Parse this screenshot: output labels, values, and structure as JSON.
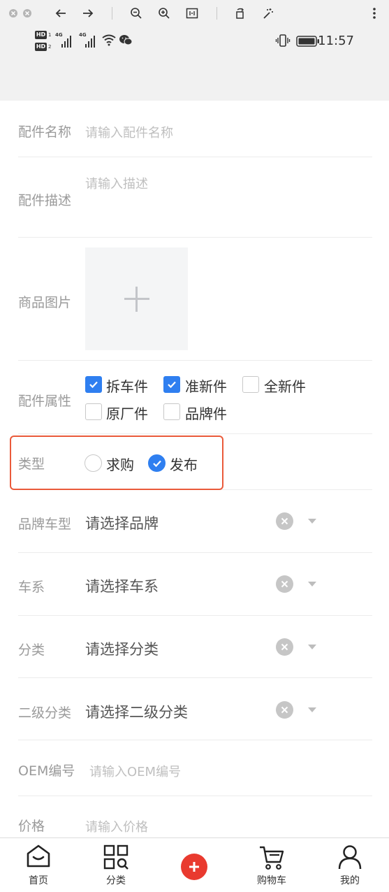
{
  "status_bar": {
    "sim1_badge": "HD",
    "sim1_num": "1",
    "sim2_badge": "HD",
    "sim2_num": "2",
    "net1": "4G",
    "net2": "4G",
    "time": "11:57",
    "icons": [
      "hd-icon",
      "signal-icon",
      "wifi-icon",
      "wechat-icon",
      "vibrate-icon",
      "battery-icon"
    ]
  },
  "viewer_toolbar": {
    "icons": [
      "close-icon",
      "minimize-icon",
      "back-arrow-icon",
      "forward-arrow-icon",
      "zoom-out-icon",
      "zoom-in-icon",
      "fit-icon",
      "rotate-icon",
      "magic-wand-icon",
      "more-icon"
    ]
  },
  "form": {
    "part_name": {
      "label": "配件名称",
      "placeholder": "请输入配件名称"
    },
    "part_desc": {
      "label": "配件描述",
      "placeholder": "请输入描述"
    },
    "product_image": {
      "label": "商品图片"
    },
    "attributes": {
      "label": "配件属性",
      "options": [
        {
          "label": "拆车件",
          "checked": true
        },
        {
          "label": "准新件",
          "checked": true
        },
        {
          "label": "全新件",
          "checked": false
        },
        {
          "label": "原厂件",
          "checked": false
        },
        {
          "label": "品牌件",
          "checked": false
        }
      ]
    },
    "type": {
      "label": "类型",
      "options": [
        {
          "label": "求购",
          "selected": false
        },
        {
          "label": "发布",
          "selected": true
        }
      ]
    },
    "brand_model": {
      "label": "品牌车型",
      "placeholder": "请选择品牌"
    },
    "series": {
      "label": "车系",
      "placeholder": "请选择车系"
    },
    "category": {
      "label": "分类",
      "placeholder": "请选择分类"
    },
    "sub_category": {
      "label": "二级分类",
      "placeholder": "请选择二级分类"
    },
    "oem": {
      "label": "OEM编号",
      "placeholder": "请输入OEM编号"
    },
    "price": {
      "label": "价格",
      "placeholder": "请输入价格"
    }
  },
  "tabbar": {
    "home": "首页",
    "category": "分类",
    "cart": "购物车",
    "mine": "我的"
  },
  "colors": {
    "accent": "#2f7ff0",
    "highlight": "#ea5a3a",
    "fab": "#e93a2f"
  }
}
